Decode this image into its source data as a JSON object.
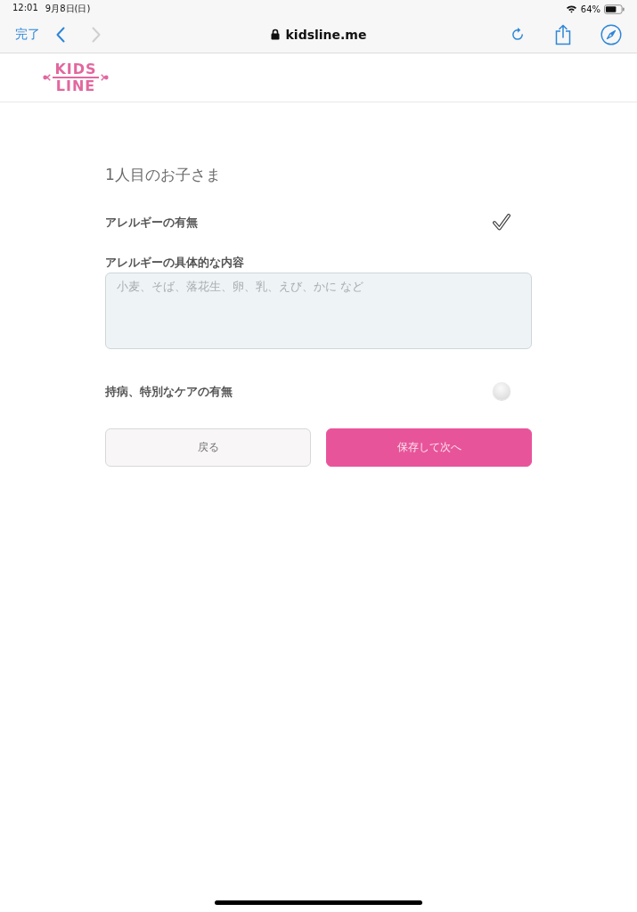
{
  "status_bar": {
    "time": "12:01",
    "date": "9月8日(日)",
    "battery": "64%"
  },
  "browser_toolbar": {
    "done": "完了",
    "nav": [
      {
        "kind": "back",
        "disabled": false
      },
      {
        "kind": "forward",
        "disabled": true
      }
    ],
    "address": "kidsline.me"
  },
  "site_header": {
    "logo": [
      "KIDS",
      "LINE"
    ]
  },
  "form": {
    "heading": "1人目のお子さま",
    "fields": [
      {
        "kind": "checkbox",
        "label": "アレルギーの有無",
        "checked": true
      },
      {
        "kind": "textarea",
        "label": "アレルギーの具体的な内容",
        "placeholder": "小麦、そば、落花生、卵、乳、えび、かに など"
      },
      {
        "kind": "checkbox",
        "label": "持病、特別なケアの有無",
        "checked": false
      }
    ],
    "buttons": [
      {
        "kind": "secondary",
        "label": "戻る"
      },
      {
        "kind": "primary",
        "label": "保存して次へ"
      }
    ]
  }
}
